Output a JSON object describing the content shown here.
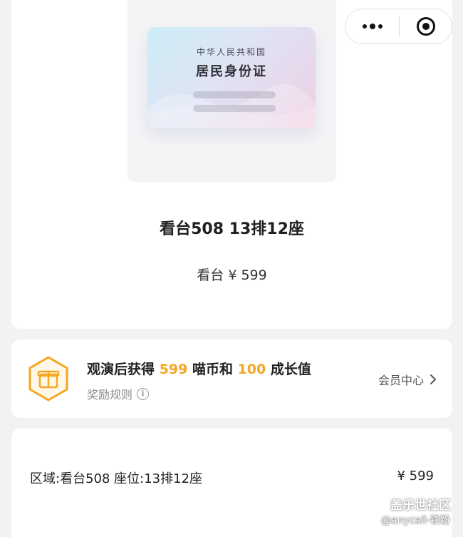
{
  "id_card": {
    "country": "中华人民共和国",
    "title": "居民身份证"
  },
  "ticket": {
    "seat_title": "看台508 13排12座",
    "price_line": "看台 ¥ 599"
  },
  "capsule": {
    "more_icon": "more-dots-icon",
    "close_icon": "target-circle-icon"
  },
  "reward": {
    "prefix": "观演后获得",
    "coins": "599",
    "mid": "喵币和",
    "growth": "100",
    "suffix": "成长值",
    "rule_label": "奖励规则",
    "member_link": "会员中心",
    "accent_color": "#f5a623"
  },
  "detail": {
    "seat_info": "区域:看台508 座位:13排12座",
    "price": "¥ 599"
  },
  "watermark": {
    "logo": "盖乐世社区",
    "user": "@anycall-铁粉"
  }
}
